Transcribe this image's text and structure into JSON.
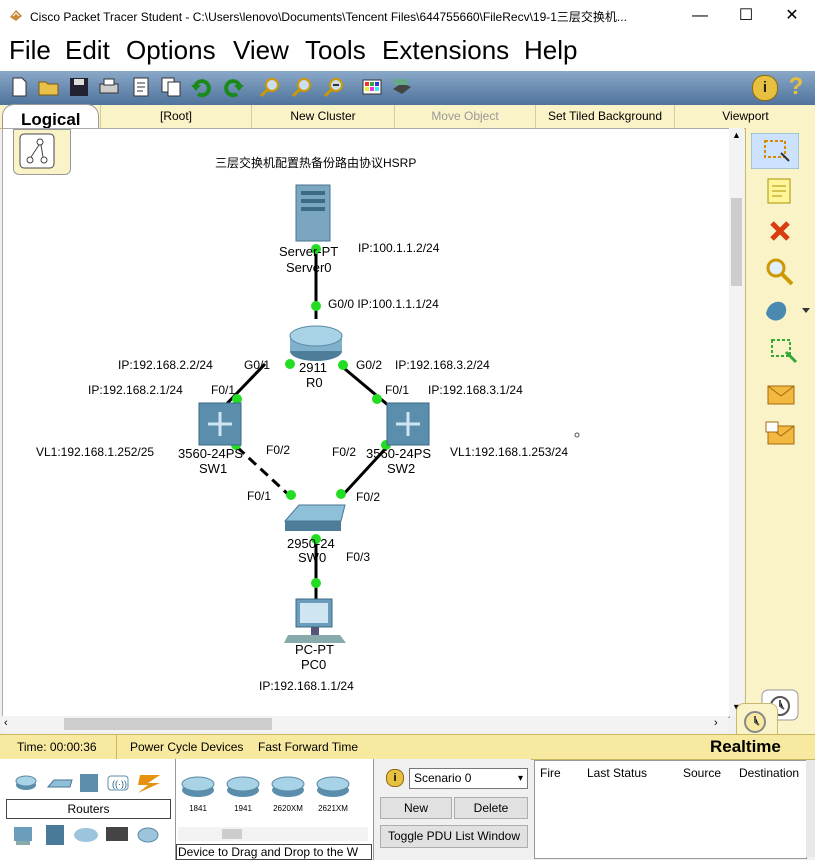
{
  "window": {
    "title": "Cisco Packet Tracer Student - C:\\Users\\lenovo\\Documents\\Tencent Files\\644755660\\FileRecv\\19-1三层交换机...",
    "minimize": "—",
    "maximize": "☐",
    "close": "✕"
  },
  "menu": [
    "File",
    "Edit",
    "Options",
    "View",
    "Tools",
    "Extensions",
    "Help"
  ],
  "toolbar": {
    "icons": [
      "new-icon",
      "open-icon",
      "save-icon",
      "print-icon",
      "activity-wizard-icon",
      "copy-icon",
      "paste-icon",
      "undo-icon",
      "redo-icon",
      "zoom-in-icon",
      "zoom-reset-icon",
      "zoom-out-icon",
      "palette-icon",
      "custom-device-icon"
    ],
    "info": "i",
    "help": "?"
  },
  "tabs": {
    "logical": "Logical",
    "items": [
      "[Root]",
      "New Cluster",
      "Move Object",
      "Set Tiled Background",
      "Viewport"
    ]
  },
  "canvas": {
    "heading": "三层交换机配置热备份路由协议HSRP",
    "devices": {
      "server": {
        "model": "Server-PT",
        "name": "Server0",
        "ip": "IP:100.1.1.2/24"
      },
      "router": {
        "model": "2911",
        "name": "R0"
      },
      "sw1": {
        "model": "3560-24PS",
        "name": "SW1",
        "vlan": "VL1:192.168.1.252/25"
      },
      "sw2": {
        "model": "3560-24PS",
        "name": "SW2",
        "vlan": "VL1:192.168.1.253/24"
      },
      "sw0": {
        "model": "2950-24",
        "name": "SW0"
      },
      "pc": {
        "model": "PC-PT",
        "name": "PC0",
        "ip": "IP:192.168.1.1/24"
      }
    },
    "labels": {
      "r0_g00": "G0/0 IP:100.1.1.1/24",
      "r0_g01_ip": "IP:192.168.2.2/24",
      "r0_g01": "G0/1",
      "r0_g02": "G0/2",
      "r0_g02_ip": "IP:192.168.3.2/24",
      "sw1_f01_ip": "IP:192.168.2.1/24",
      "sw1_f01": "F0/1",
      "sw2_f01": "F0/1",
      "sw2_f01_ip": "IP:192.168.3.1/24",
      "sw1_f02": "F0/2",
      "sw2_f02": "F0/2",
      "sw0_f01": "F0/1",
      "sw0_f02": "F0/2",
      "sw0_f03": "F0/3"
    }
  },
  "palette": [
    "select-icon",
    "note-icon",
    "delete-icon",
    "inspect-icon",
    "draw-shape-icon",
    "resize-icon",
    "add-simple-pdu-icon",
    "add-complex-pdu-icon"
  ],
  "status": {
    "time": "Time: 00:00:36",
    "power_cycle": "Power Cycle Devices",
    "fast_forward": "Fast Forward Time",
    "mode": "Realtime"
  },
  "device_panel": {
    "category": "Routers",
    "models": [
      "1841",
      "1941",
      "2620XM",
      "2621XM"
    ],
    "hint": "Device to Drag and Drop to the W"
  },
  "scenario": {
    "selected": "Scenario 0",
    "new": "New",
    "delete": "Delete",
    "toggle": "Toggle PDU List Window",
    "columns": [
      "Fire",
      "Last Status",
      "Source",
      "Destination"
    ]
  }
}
